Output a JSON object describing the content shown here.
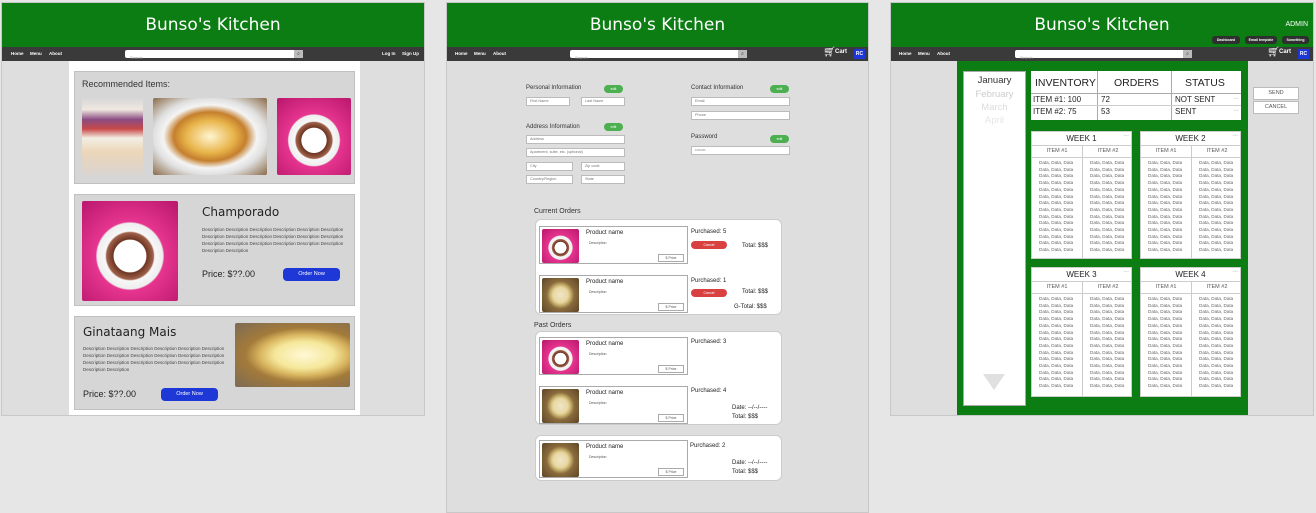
{
  "app": {
    "title": "Bunso's Kitchen"
  },
  "nav": {
    "home": "Home",
    "menu": "Menu",
    "about": "About",
    "search_placeholder": "Search",
    "login": "Log In",
    "signup": "Sign Up",
    "cart": "Cart",
    "avatar": "RC"
  },
  "home": {
    "recommended_heading": "Recommended Items:",
    "items": [
      {
        "name": "Champorado",
        "description": "Description Description Description Description Description Description Description Description Description Description Description Description Description Description Description Description Description Description Description Description",
        "price": "Price: $??.00",
        "button": "Order Now"
      },
      {
        "name": "Ginataang Mais",
        "description": "Description Description Description Description Description Description Description Description Description Description Description Description Description Description Description Description Description Description Description Description",
        "price": "Price: $??.00",
        "button": "Order Now"
      }
    ]
  },
  "profile": {
    "personal": {
      "heading": "Personal Information",
      "edit": "edit",
      "first_name": "First Name",
      "last_name": "Last Name"
    },
    "contact": {
      "heading": "Contact Information",
      "edit": "edit",
      "email": "Email",
      "phone": "Phone"
    },
    "address": {
      "heading": "Address Information",
      "edit": "edit",
      "address": "Address",
      "apartment": "Apartment, suite, etc. (optional)",
      "city": "City",
      "zip": "Zip code",
      "country": "Country/Region",
      "state": "State"
    },
    "password": {
      "heading": "Password",
      "edit": "edit",
      "value": "••••••••"
    }
  },
  "orders": {
    "current_heading": "Current Orders",
    "past_heading": "Past Orders",
    "product_name": "Product name",
    "description": "Description",
    "price": "$ Price",
    "cancel": "Cancel",
    "current": [
      {
        "purchased": "Purchased:  5",
        "total": "Total: $$$"
      },
      {
        "purchased": "Purchased:  1",
        "total": "Total: $$$",
        "gtotal": "G-Total: $$$"
      }
    ],
    "past": [
      {
        "purchased": "Purchased:  3"
      },
      {
        "purchased": "Purchased:  4",
        "date": "Date: --/--/----",
        "total": "Total: $$$"
      },
      {
        "purchased": "Purchased:  2",
        "date": "Date: --/--/----",
        "total": "Total: $$$"
      }
    ]
  },
  "admin": {
    "label": "ADMIN",
    "buttons": [
      "Dashboard",
      "Email template",
      "Something"
    ],
    "months": [
      "January",
      "February",
      "March",
      "April"
    ],
    "inventory": {
      "headers": [
        "INVENTORY",
        "ORDERS",
        "STATUS"
      ],
      "rows": [
        [
          "ITEM #1: 100",
          "72",
          "NOT SENT"
        ],
        [
          "ITEM #2: 75",
          "53",
          "SENT"
        ]
      ],
      "more": "◦◦◦"
    },
    "weeks": [
      "WEEK 1",
      "WEEK 2",
      "WEEK 3",
      "WEEK 4"
    ],
    "item_headers": [
      "ITEM #1",
      "ITEM #2"
    ],
    "cell": "Data, Data, Data",
    "send": "SEND",
    "cancel": "CANCEL"
  },
  "colors": {
    "header_green": "#0b7d12",
    "nav_dark": "#3a3a3a",
    "button_blue": "#1d38d6",
    "edit_green": "#4caf50",
    "cancel_red": "#d94040"
  }
}
